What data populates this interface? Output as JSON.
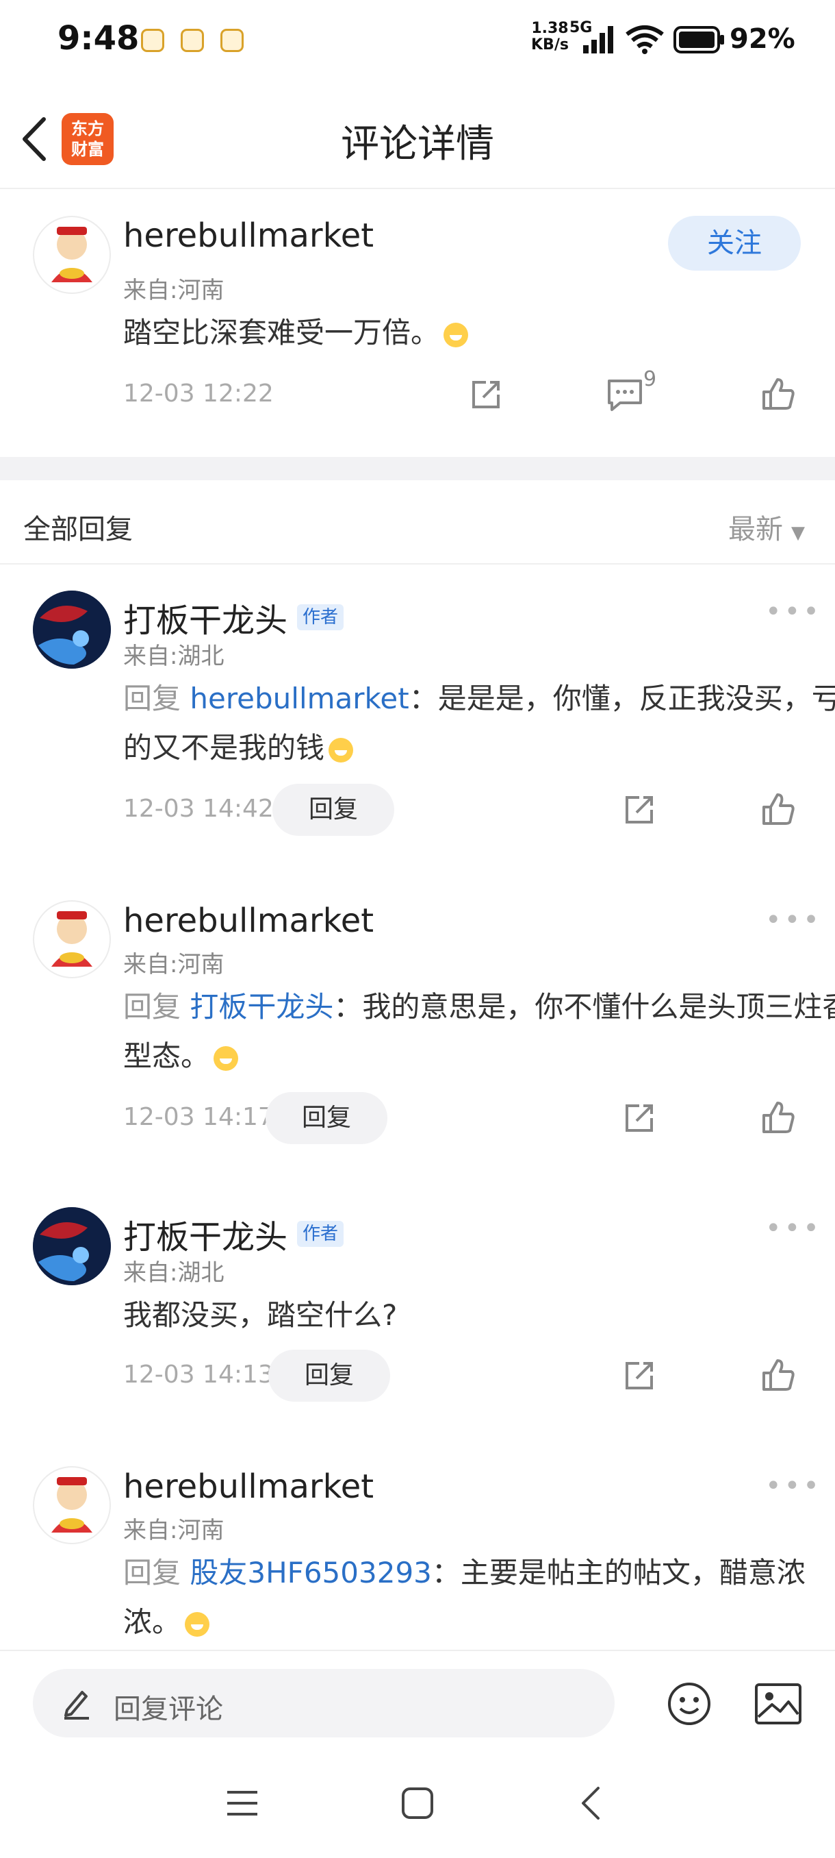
{
  "status_bar": {
    "time": "9:48",
    "net_speed_value": "1.38",
    "net_speed_unit": "KB/s",
    "network": "5G",
    "battery": "92%",
    "icons": [
      "signal-icon",
      "wifi-icon",
      "battery-icon"
    ]
  },
  "header": {
    "title": "评论详情",
    "logo_line1": "东方",
    "logo_line2": "财富",
    "brand_color": "#f05a22"
  },
  "main_comment": {
    "author": "herebullmarket",
    "location": "来自:河南",
    "text": "踏空比深套难受一万倍。",
    "timestamp": "12-03 12:22",
    "follow_label": "关注",
    "reply_count": "9"
  },
  "replies_section": {
    "label": "全部回复",
    "sort_label": "最新"
  },
  "replies": [
    {
      "author": "打板干龙头",
      "badge": "作者",
      "location": "来自:湖北",
      "prefix": "回复",
      "mention": "herebullmarket",
      "text": "：是是是，你懂，反正我没买，亏的又不是我的钱",
      "timestamp": "12-03 14:42",
      "reply_label": "回复"
    },
    {
      "author": "herebullmarket",
      "location": "来自:河南",
      "prefix": "回复",
      "mention": "打板干龙头",
      "text": "：我的意思是，你不懂什么是头顶三炷香型态。",
      "timestamp": "12-03 14:17",
      "reply_label": "回复"
    },
    {
      "author": "打板干龙头",
      "badge": "作者",
      "location": "来自:湖北",
      "text": "我都没买，踏空什么?",
      "timestamp": "12-03 14:13",
      "reply_label": "回复"
    },
    {
      "author": "herebullmarket",
      "location": "来自:河南",
      "prefix": "回复",
      "mention": "股友3HF6503293",
      "text": "：主要是帖主的帖文，醋意浓浓。"
    }
  ],
  "bottom_bar": {
    "placeholder": "回复评论"
  },
  "colors": {
    "mention": "#2a6fc6",
    "follow_bg": "#e4eefb",
    "follow_text": "#2e78db"
  }
}
